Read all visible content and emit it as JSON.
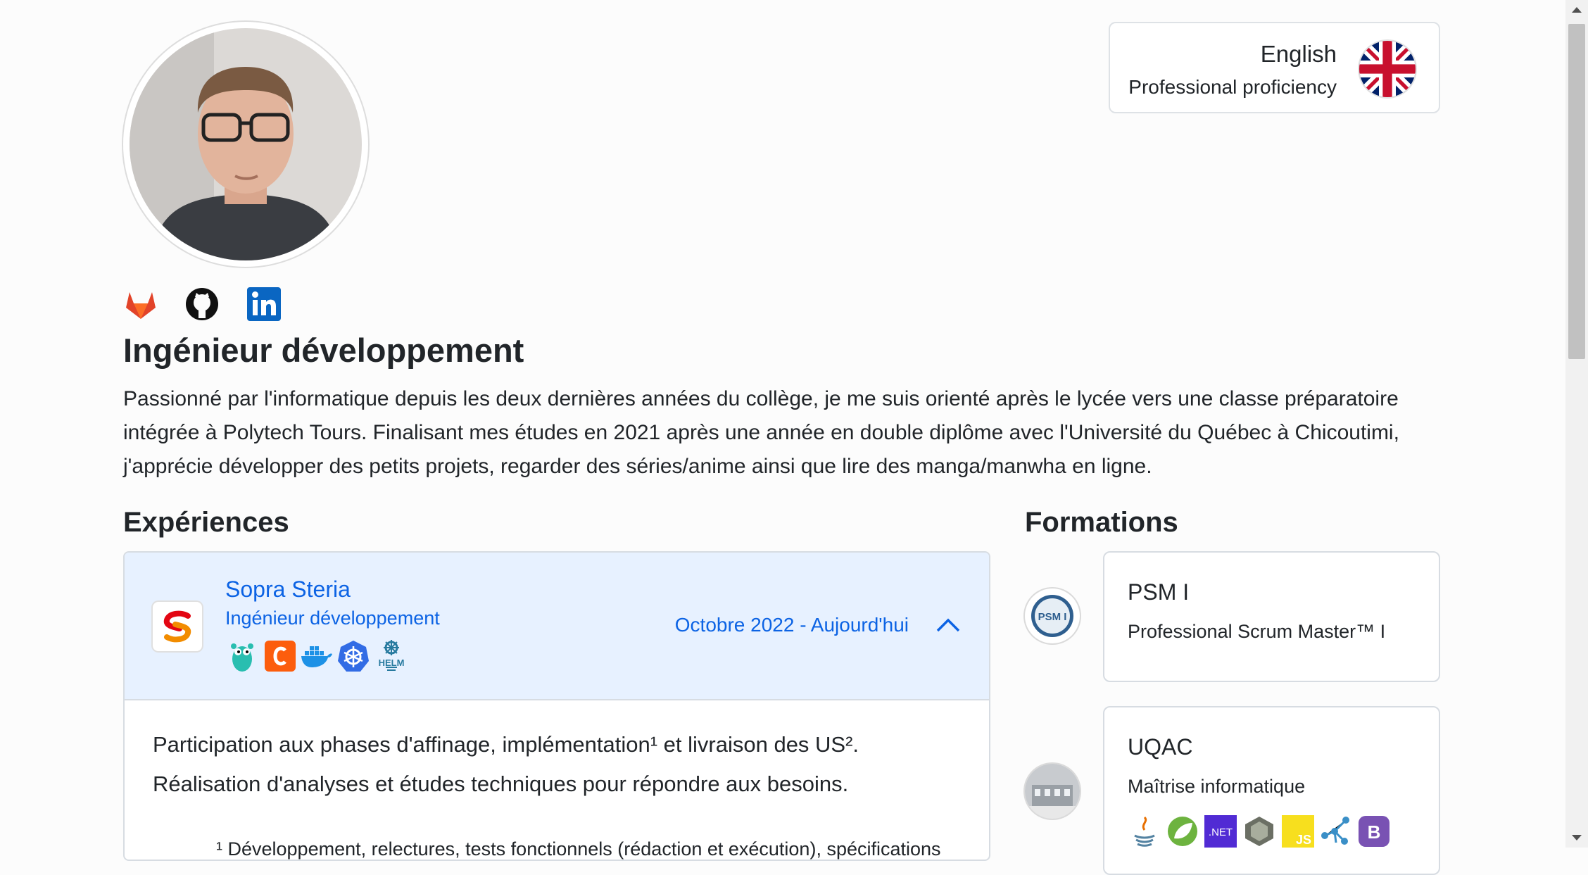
{
  "profile": {
    "title": "Ingénieur développement",
    "bio": "Passionné par l'informatique depuis les deux dernières années du collège, je me suis orienté après le lycée vers une classe préparatoire intégrée à Polytech Tours. Finalisant mes études en 2021 après une année en double diplôme avec l'Université du Québec à Chicoutimi, j'apprécie développer des petits projets, regarder des séries/anime ainsi que lire des manga/manwha en ligne."
  },
  "socials": [
    "gitlab-icon",
    "github-icon",
    "linkedin-icon"
  ],
  "language": {
    "name": "English",
    "level": "Professional proficiency",
    "flag": "uk-flag-icon"
  },
  "sections": {
    "experiences": "Expériences",
    "formations": "Formations"
  },
  "experience": {
    "company": "Sopra Steria",
    "role": "Ingénieur développement",
    "dates": "Octobre 2022 - Aujourd'hui",
    "technologies": [
      "go-gopher-icon",
      "camunda-icon",
      "docker-icon",
      "kubernetes-icon",
      "helm-icon"
    ],
    "line1": "Participation aux phases d'affinage, implémentation¹ et livraison des US².",
    "line2": "Réalisation d'analyses et études techniques pour répondre aux besoins.",
    "footnote1": "¹ Développement, relectures, tests fonctionnels (rédaction et exécution), spécifications"
  },
  "formations": [
    {
      "name": "PSM I",
      "desc": "Professional Scrum Master™ I",
      "badge": "PSM I"
    },
    {
      "name": "UQAC",
      "desc": "Maîtrise informatique",
      "technologies": [
        "java-icon",
        "spring-icon",
        "dotnet-icon",
        "nuxt-icon",
        "javascript-icon",
        "graph-icon",
        "bootstrap-icon"
      ],
      "labels": {
        "dotnet": ".NET",
        "js": "JS",
        "bootstrap": "B"
      }
    }
  ],
  "colors": {
    "accent": "#0c63e4",
    "accent_bg": "#e7f1ff",
    "text": "#212529"
  }
}
